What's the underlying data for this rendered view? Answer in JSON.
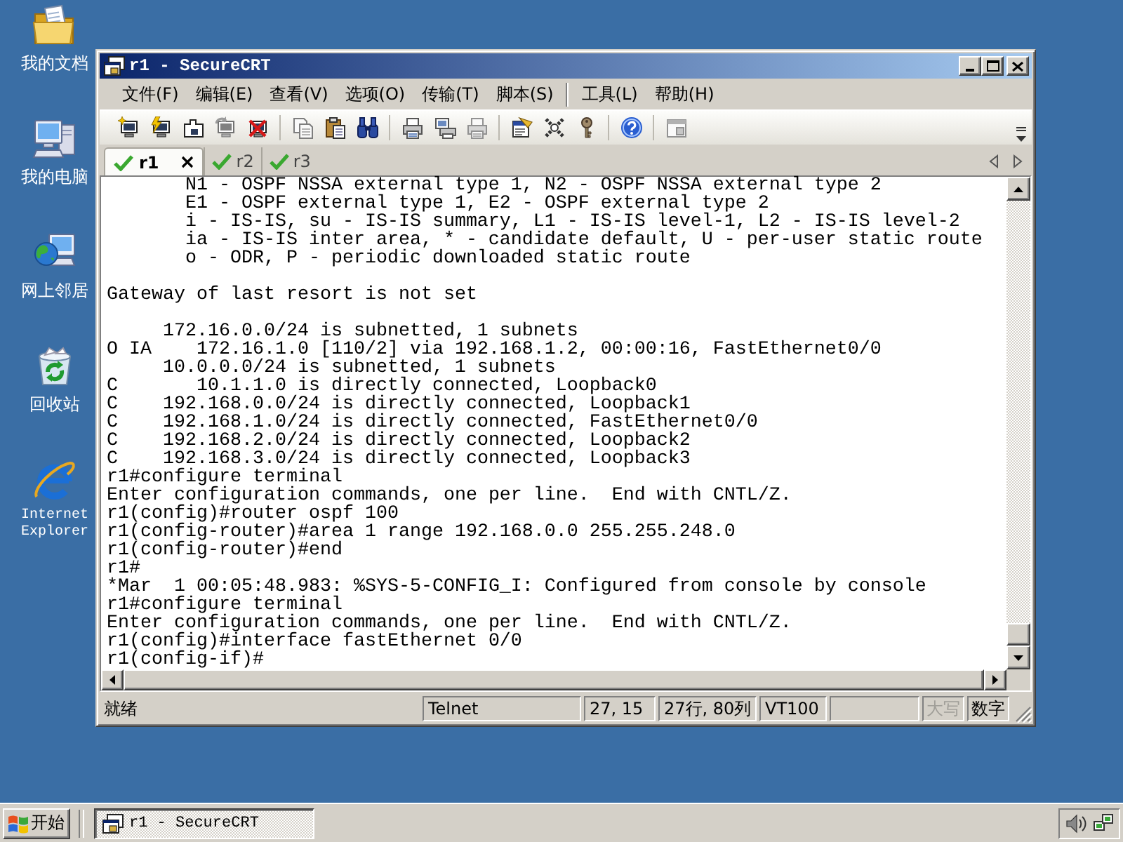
{
  "desktop": {
    "icons": [
      {
        "kind": "documents",
        "label": "我的文档"
      },
      {
        "kind": "computer",
        "label": "我的电脑"
      },
      {
        "kind": "network",
        "label": "网上邻居"
      },
      {
        "kind": "recycle",
        "label": "回收站"
      },
      {
        "kind": "browser",
        "label": "Internet Explorer"
      }
    ]
  },
  "window": {
    "title": "r1 - SecureCRT"
  },
  "menu_groups": [
    [
      "文件(F)",
      "编辑(E)",
      "查看(V)",
      "选项(O)",
      "传输(T)",
      "脚本(S)"
    ],
    [
      "工具(L)",
      "帮助(H)"
    ]
  ],
  "toolbar_groups": [
    [
      {
        "kind": "connect",
        "disabled": false
      },
      {
        "kind": "quickconnect",
        "disabled": false
      },
      {
        "kind": "tabconnect",
        "disabled": false
      },
      {
        "kind": "reconnect",
        "disabled": true
      },
      {
        "kind": "disconnect",
        "disabled": false
      }
    ],
    [
      {
        "kind": "copy",
        "disabled": true
      },
      {
        "kind": "paste",
        "disabled": false
      },
      {
        "kind": "find",
        "disabled": false
      }
    ],
    [
      {
        "kind": "print",
        "disabled": false
      },
      {
        "kind": "printselection",
        "disabled": false
      },
      {
        "kind": "printsetup",
        "disabled": true
      }
    ],
    [
      {
        "kind": "sessionoptions",
        "disabled": false
      },
      {
        "kind": "globaloptions",
        "disabled": false
      },
      {
        "kind": "keys",
        "disabled": false
      }
    ],
    [
      {
        "kind": "help",
        "disabled": false
      }
    ],
    [
      {
        "kind": "window",
        "disabled": true
      }
    ]
  ],
  "tabs": [
    {
      "label": "r1",
      "selected": true,
      "connected": true
    },
    {
      "label": "r2",
      "selected": false,
      "connected": true
    },
    {
      "label": "r3",
      "selected": false,
      "connected": true
    }
  ],
  "terminal": {
    "blocks": [
      [
        "       N1 - OSPF NSSA external type 1, N2 - OSPF NSSA external type 2",
        "       E1 - OSPF external type 1, E2 - OSPF external type 2",
        "       i - IS-IS, su - IS-IS summary, L1 - IS-IS level-1, L2 - IS-IS level-2",
        "       ia - IS-IS inter area, * - candidate default, U - per-user static route",
        "       o - ODR, P - periodic downloaded static route"
      ],
      [
        "Gateway of last resort is not set"
      ],
      [
        "     172.16.0.0/24 is subnetted, 1 subnets",
        "O IA    172.16.1.0 [110/2] via 192.168.1.2, 00:00:16, FastEthernet0/0",
        "     10.0.0.0/24 is subnetted, 1 subnets",
        "C       10.1.1.0 is directly connected, Loopback0",
        "C    192.168.0.0/24 is directly connected, Loopback1",
        "C    192.168.1.0/24 is directly connected, FastEthernet0/0",
        "C    192.168.2.0/24 is directly connected, Loopback2",
        "C    192.168.3.0/24 is directly connected, Loopback3",
        "r1#configure terminal",
        "Enter configuration commands, one per line.  End with CNTL/Z.",
        "r1(config)#router ospf 100",
        "r1(config-router)#area 1 range 192.168.0.0 255.255.248.0",
        "r1(config-router)#end",
        "r1#",
        "*Mar  1 00:05:48.983: %SYS-5-CONFIG_I: Configured from console by console",
        "r1#configure terminal",
        "Enter configuration commands, one per line.  End with CNTL/Z.",
        "r1(config)#interface fastEthernet 0/0",
        "r1(config-if)#"
      ]
    ]
  },
  "status_bar": {
    "message": "就绪",
    "panels": [
      "Telnet",
      "27, 15",
      "27行, 80列",
      "VT100"
    ],
    "indicators": [
      {
        "label": "大写",
        "on": false
      },
      {
        "label": "数字",
        "on": true
      }
    ]
  },
  "taskbar": {
    "start": "开始",
    "tasks": [
      {
        "label": "r1 - SecureCRT",
        "selected": true
      }
    ]
  }
}
